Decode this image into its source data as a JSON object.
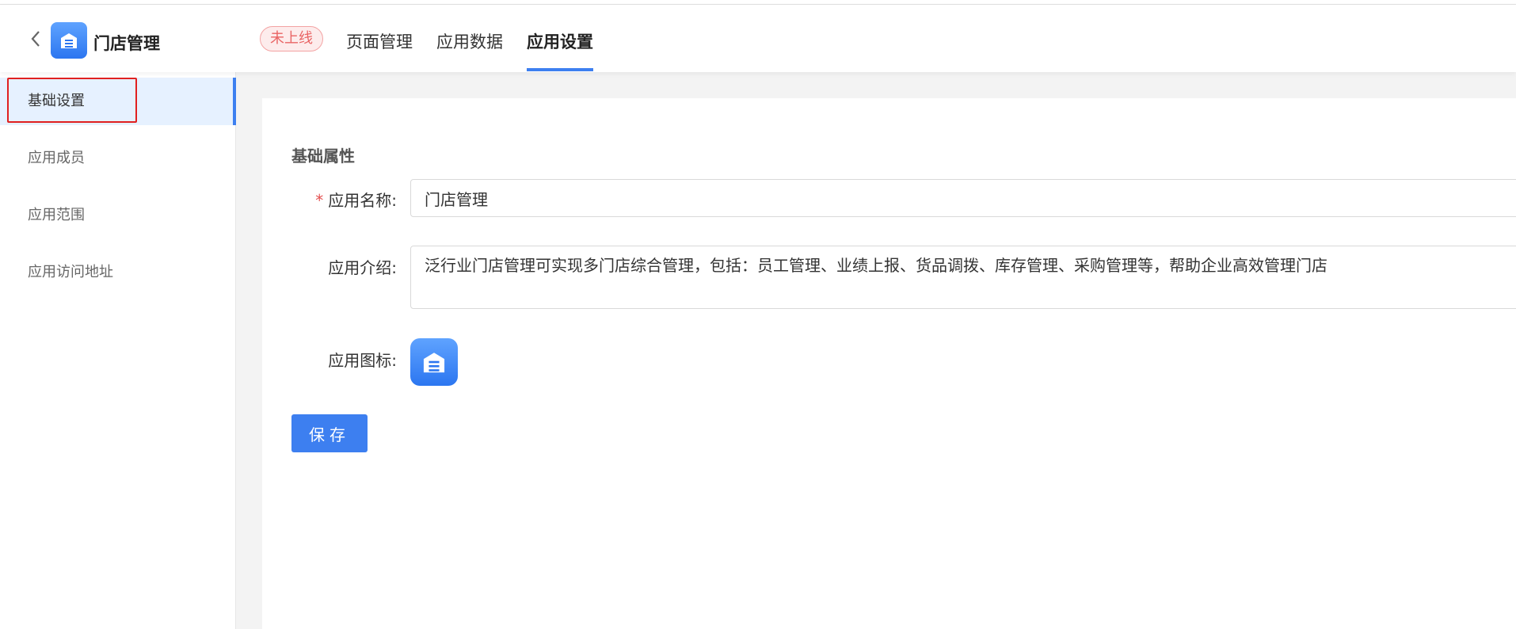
{
  "header": {
    "app_title": "门店管理",
    "status_badge": "未上线",
    "tabs": [
      {
        "label": "页面管理"
      },
      {
        "label": "应用数据"
      },
      {
        "label": "应用设置"
      }
    ]
  },
  "sidebar": {
    "items": [
      {
        "label": "基础设置"
      },
      {
        "label": "应用成员"
      },
      {
        "label": "应用范围"
      },
      {
        "label": "应用访问地址"
      }
    ]
  },
  "form": {
    "section_title": "基础属性",
    "name_label": "应用名称:",
    "name_value": "门店管理",
    "intro_label": "应用介绍:",
    "intro_value": "泛行业门店管理可实现多门店综合管理，包括：员工管理、业绩上报、货品调拨、库存管理、采购管理等，帮助企业高效管理门店",
    "icon_label": "应用图标:",
    "save_label": "保存"
  },
  "colors": {
    "accent": "#3d7ff0",
    "badge_text": "#e96565",
    "highlight_box": "#e02020"
  }
}
